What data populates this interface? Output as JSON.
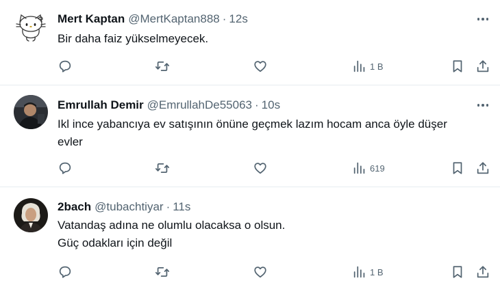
{
  "tweets": [
    {
      "name": "Mert Kaptan",
      "handle": "@MertKaptan888",
      "dot": "·",
      "time": "12s",
      "lines": [
        "Bir daha faiz yükselmeyecek."
      ],
      "views": "1 B"
    },
    {
      "name": "Emrullah Demir",
      "handle": "@EmrullahDe55063",
      "dot": "·",
      "time": "10s",
      "lines": [
        "Ikl ince yabancıya ev satışının önüne geçmek lazım hocam anca öyle düşer",
        "evler"
      ],
      "views": "619"
    },
    {
      "name": "2bach",
      "handle": "@tubachtiyar",
      "dot": "·",
      "time": "11s",
      "lines": [
        "Vatandaş adına ne olumlu olacaksa o olsun.",
        "Güç odakları için değil"
      ],
      "views": "1 B"
    }
  ],
  "icons": {
    "reply": "reply-icon",
    "retweet": "retweet-icon",
    "like": "heart-icon",
    "views": "views-chart-icon",
    "bookmark": "bookmark-icon",
    "share": "share-icon",
    "more": "more-dots-icon"
  },
  "colors": {
    "text": "#0f1419",
    "secondary": "#536471",
    "divider": "#e6ecf0",
    "background": "#ffffff"
  }
}
